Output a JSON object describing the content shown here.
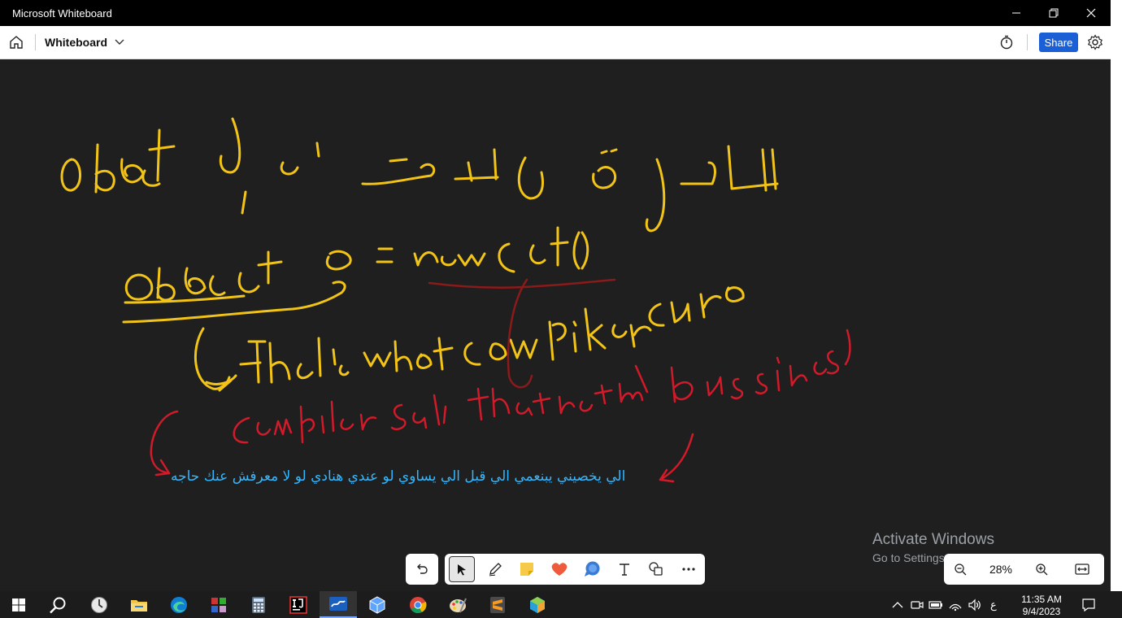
{
  "window": {
    "title": "Microsoft Whiteboard"
  },
  "appbar": {
    "board_name": "Whiteboard",
    "share_label": "Share"
  },
  "canvas": {
    "arabic_note": "الي يخصيني يبنعمي الي قبل الي يساوي لو عندي هنادي لو لا معرفش عنك حاجه",
    "ink_colors": {
      "yellow": "#f2c417",
      "red": "#d11a2a",
      "darkred": "#8b1a1a",
      "blue_text": "#33b7ff"
    }
  },
  "watermark": {
    "line1": "Activate Windows",
    "line2": "Go to Settings to activate Windows."
  },
  "toolbar": {
    "tools": [
      "undo-icon",
      "select-icon",
      "pen-icon",
      "sticky-note-icon",
      "reaction-heart-icon",
      "chat-bubble-icon",
      "text-icon",
      "shapes-icon",
      "more-icon"
    ]
  },
  "zoom": {
    "value": "28%"
  },
  "taskbar": {
    "apps": [
      "start-icon",
      "search-icon",
      "clock-app-icon",
      "file-explorer-icon",
      "edge-icon",
      "winrar-icon",
      "calculator-icon",
      "intellij-icon",
      "whiteboard-icon",
      "virtualbox-icon",
      "chrome-icon",
      "paint-icon",
      "sublime-icon",
      "app-box-icon"
    ],
    "ime": "ع",
    "time": "11:35 AM",
    "date": "9/4/2023"
  }
}
